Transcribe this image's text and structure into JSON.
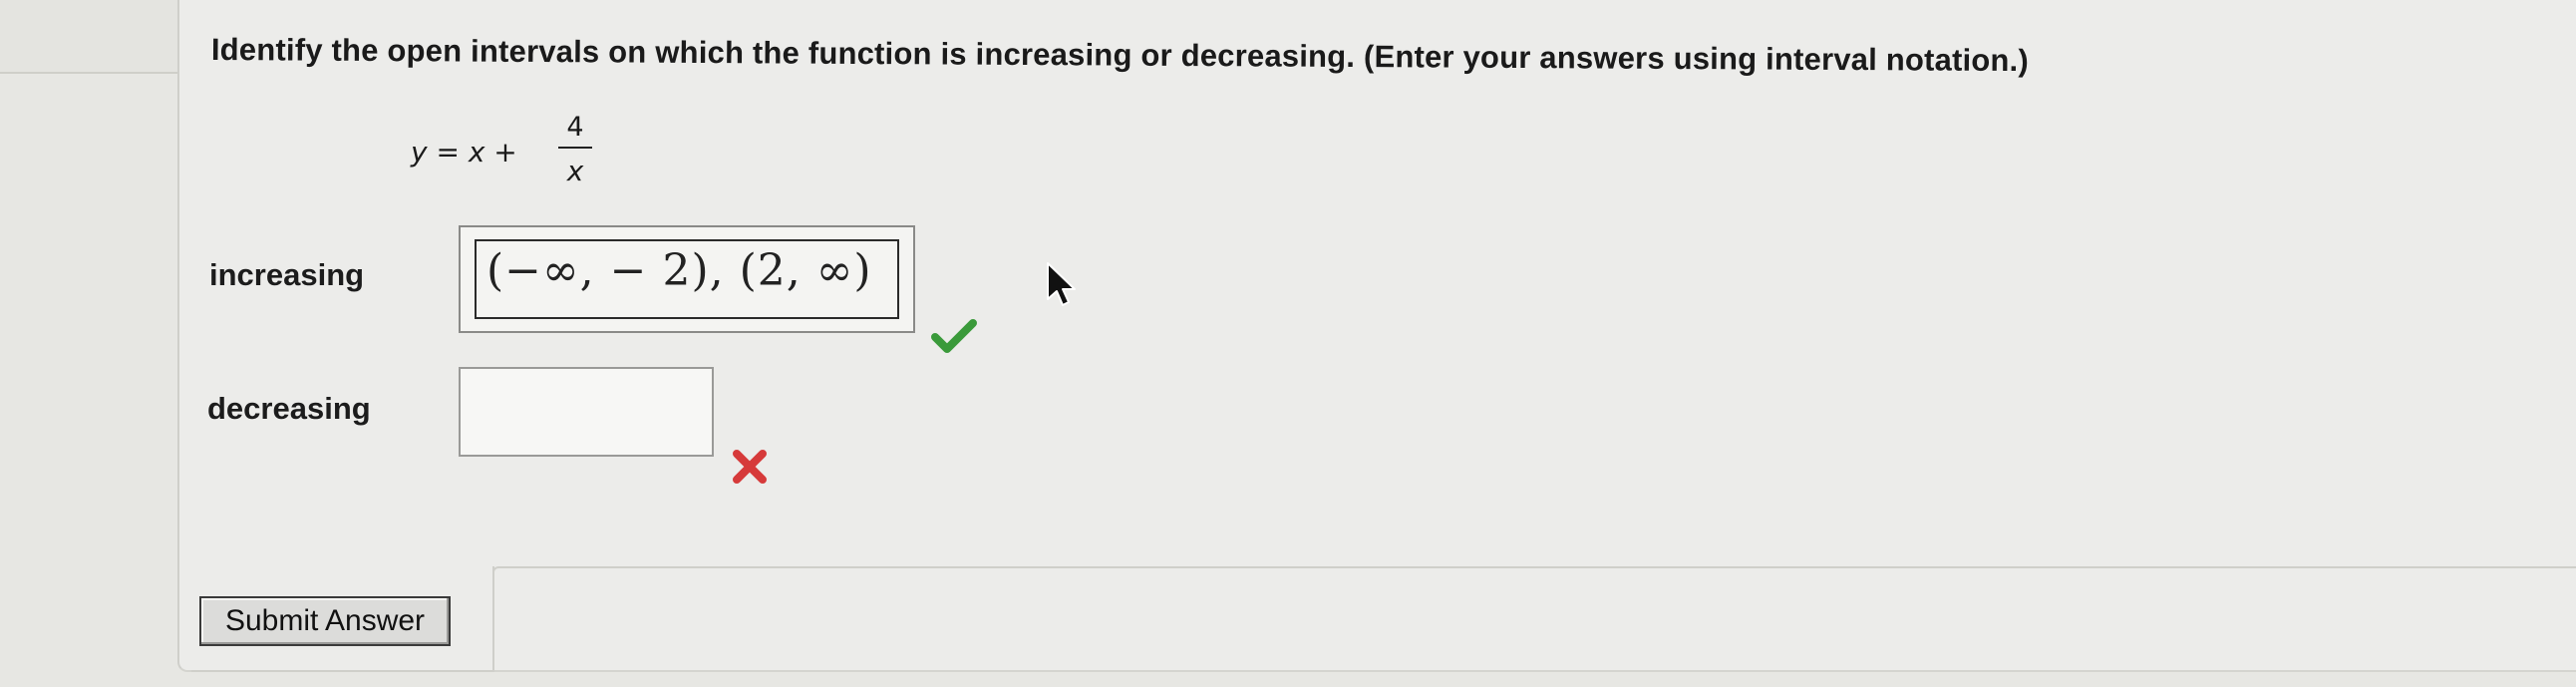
{
  "question": {
    "text": "Identify the open intervals on which the function is increasing or decreasing. (Enter your answers using interval notation.)"
  },
  "equation": {
    "lhs": "y = x +",
    "numerator": "4",
    "denominator": "x"
  },
  "increasing": {
    "label": "increasing",
    "value": "(−∞, − 2), (2, ∞)",
    "status": "correct",
    "status_color": "#3a9a3a"
  },
  "decreasing": {
    "label": "decreasing",
    "value": "",
    "status": "incorrect",
    "status_color": "#d63a3a"
  },
  "submit": {
    "label": "Submit Answer"
  },
  "icons": {
    "check": "check-icon",
    "cross": "cross-icon",
    "cursor": "mouse-pointer-icon"
  }
}
